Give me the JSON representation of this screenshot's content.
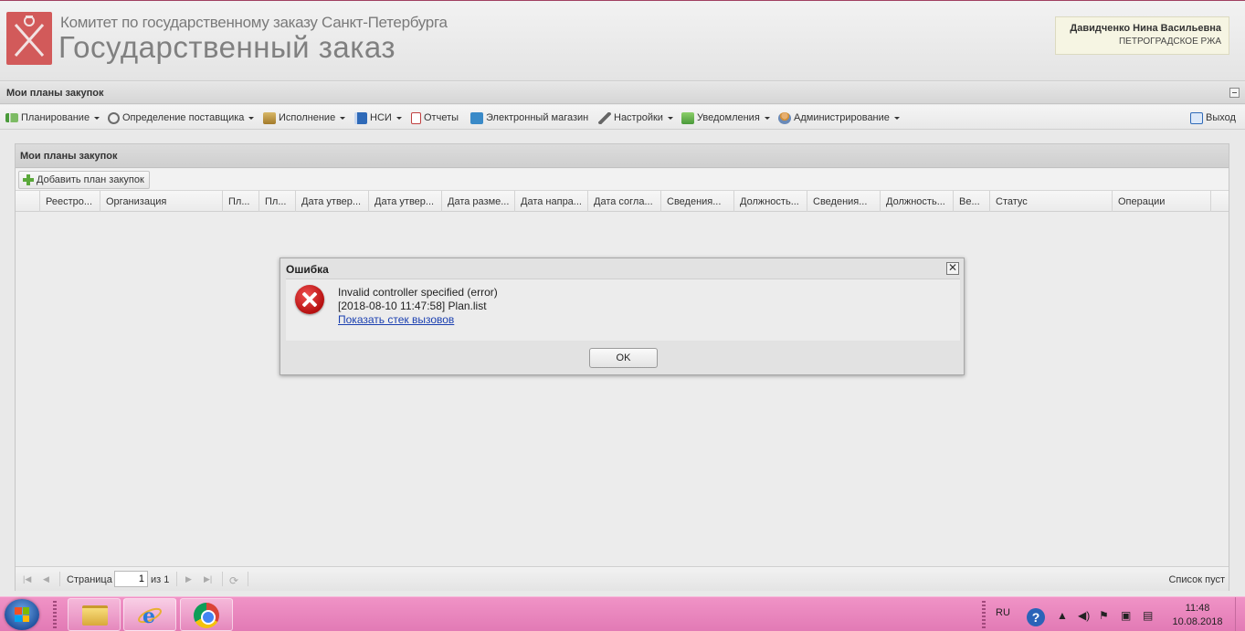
{
  "header": {
    "org_line": "Комитет по государственному заказу Санкт-Петербурга",
    "title": "Государственный заказ",
    "user_name": "Давидченко Нина Васильевна",
    "user_dept": "ПЕТРОГРАДСКОЕ РЖА"
  },
  "panel": {
    "title": "Мои планы закупок"
  },
  "menu": {
    "items": [
      {
        "label": "Планирование",
        "icon": "planning-icon",
        "color": "#4a9a3a"
      },
      {
        "label": "Определение поставщика",
        "icon": "gears-icon",
        "color": "#6b6b6b"
      },
      {
        "label": "Исполнение",
        "icon": "execution-icon",
        "color": "#b08a3a"
      },
      {
        "label": "НСИ",
        "icon": "book-icon",
        "color": "#2f6ab8"
      },
      {
        "label": "Отчеты",
        "icon": "report-icon",
        "color": "#c04040"
      },
      {
        "label": "Электронный магазин",
        "icon": "cart-icon",
        "color": "#3a8ac8"
      },
      {
        "label": "Настройки",
        "icon": "wrench-icon",
        "color": "#666666"
      },
      {
        "label": "Уведомления",
        "icon": "notifications-icon",
        "color": "#5aa83a"
      },
      {
        "label": "Администрирование",
        "icon": "admin-user-icon",
        "color": "#d0903a"
      }
    ],
    "exit_label": "Выход"
  },
  "grid": {
    "title": "Мои планы закупок",
    "add_label": "Добавить план закупок",
    "columns": [
      "Реестро...",
      "Организация",
      "Пл...",
      "Пл...",
      "Дата утвер...",
      "Дата утвер...",
      "Дата разме...",
      "Дата напра...",
      "Дата согла...",
      "Сведения...",
      "Должность...",
      "Сведения...",
      "Должность...",
      "Ве...",
      "Статус",
      "Операции"
    ],
    "pager": {
      "page_label": "Страница",
      "page_value": "1",
      "of_label": "из 1",
      "status": "Список пуст"
    }
  },
  "dialog": {
    "title": "Ошибка",
    "close_glyph": "✕",
    "message_line1": "Invalid controller specified (error)",
    "message_line2": "[2018-08-10 11:47:58] Plan.list",
    "link": "Показать стек вызовов",
    "ok_label": "OK"
  },
  "taskbar": {
    "lang": "RU",
    "time": "11:48",
    "date": "10.08.2018"
  }
}
